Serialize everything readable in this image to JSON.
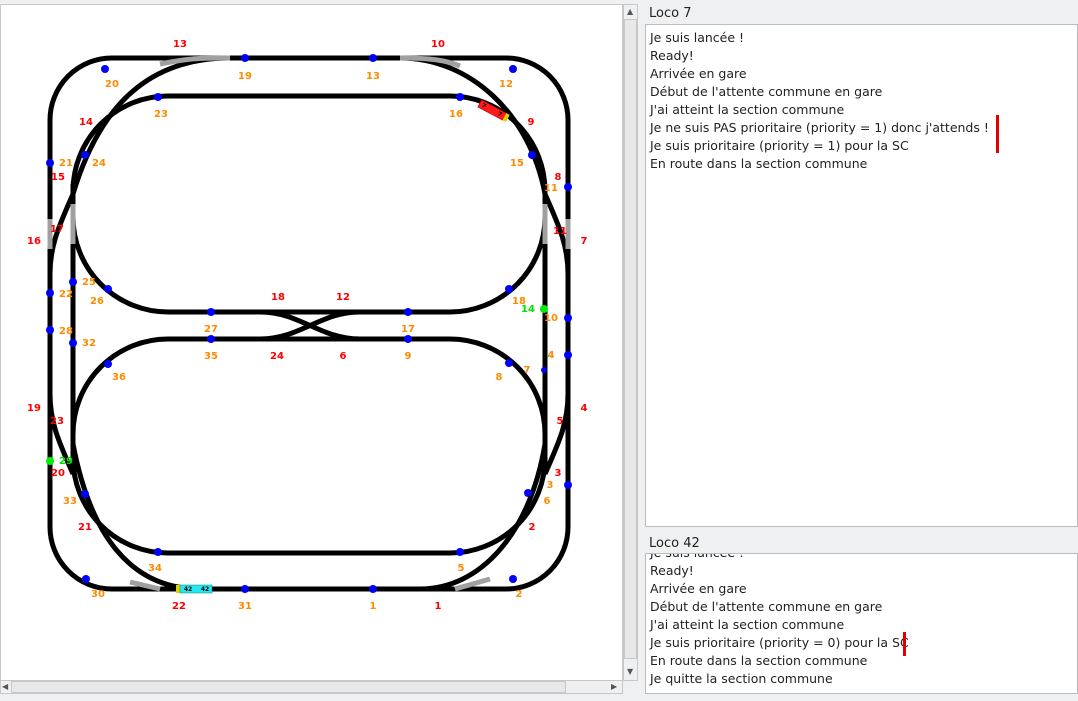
{
  "layout_view": {
    "sensor_labels": [
      "20",
      "19",
      "13",
      "12",
      "23",
      "16",
      "21",
      "24",
      "15",
      "11",
      "25",
      "22",
      "26",
      "28",
      "32",
      "27",
      "18",
      "10",
      "17",
      "35",
      "9",
      "36",
      "4",
      "7",
      "8",
      "33",
      "3",
      "6",
      "34",
      "5",
      "30",
      "31",
      "1",
      "2"
    ],
    "active_sensor_labels": [
      "14",
      "29"
    ],
    "block_labels": [
      "13",
      "10",
      "14",
      "9",
      "15",
      "8",
      "16",
      "17",
      "11",
      "7",
      "18",
      "12",
      "24",
      "6",
      "19",
      "23",
      "5",
      "4",
      "20",
      "3",
      "21",
      "2",
      "22",
      "1"
    ],
    "locos": [
      {
        "id": "7",
        "color": "#ff1a1a"
      },
      {
        "id": "42",
        "color": "#22e6f0"
      }
    ],
    "colors": {
      "track": "#000000",
      "switch_inactive": "#a0a0a0",
      "sensor": "#0000ff",
      "sensor_active": "#00ee00",
      "sensor_label": "#ff8a00",
      "block_label": "#ff0000"
    }
  },
  "panels": [
    {
      "title": "Loco 7",
      "lines": [
        "Je suis lancée !",
        "Ready!",
        "Arrivée en gare",
        "Début de l'attente commune en gare",
        "J'ai atteint la section commune",
        "Je ne suis PAS prioritaire (priority = 1) donc j'attends !",
        "Je suis prioritaire (priority = 1) pour la SC",
        "En route dans la section commune"
      ]
    },
    {
      "title": "Loco 42",
      "lines": [
        "Je suis lancée !",
        "Ready!",
        "Arrivée en gare",
        "Début de l'attente commune en gare",
        "J'ai atteint la section commune",
        "Je suis prioritaire (priority = 0) pour la SC",
        "En route dans la section commune",
        "Je quitte la section commune"
      ]
    }
  ]
}
